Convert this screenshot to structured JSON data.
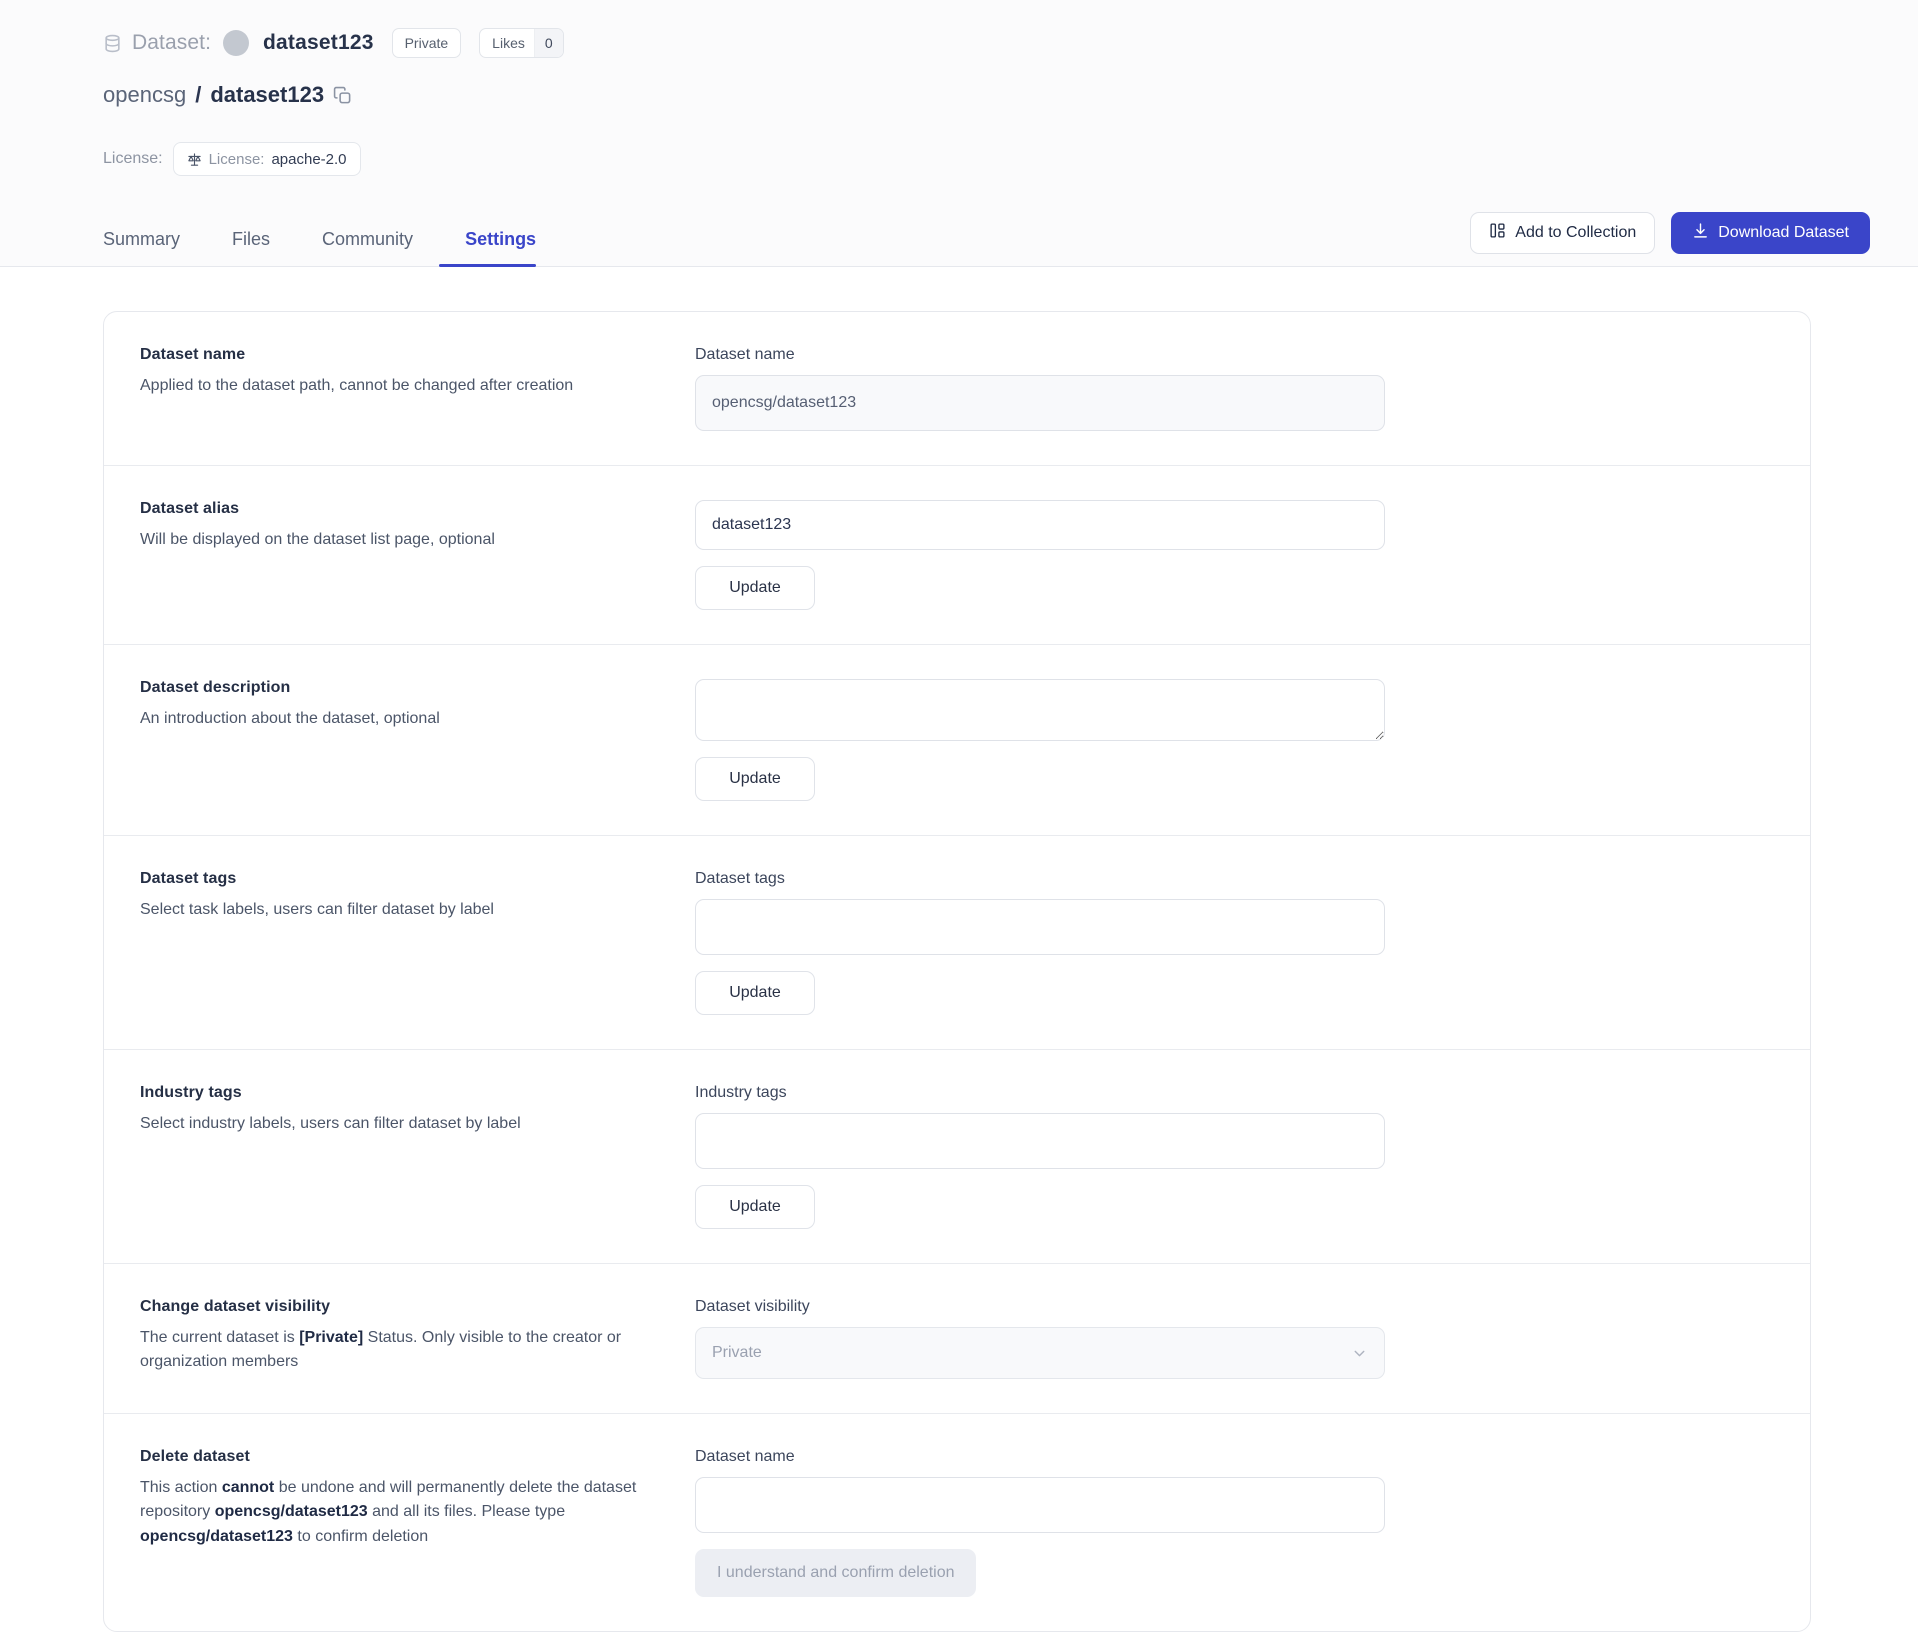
{
  "header": {
    "kicker": "Dataset:",
    "dataset_name": "dataset123",
    "private_badge": "Private",
    "likes_label": "Likes",
    "likes_count": "0",
    "owner": "opencsg",
    "separator": "/",
    "repo": "dataset123",
    "license_label": "License:",
    "license_badge_label": "License:",
    "license_value": "apache-2.0",
    "accent_color": "#3a45c9"
  },
  "tabs": [
    {
      "label": "Summary",
      "active": false
    },
    {
      "label": "Files",
      "active": false
    },
    {
      "label": "Community",
      "active": false
    },
    {
      "label": "Settings",
      "active": true
    }
  ],
  "actions": {
    "add_to_collection": "Add to Collection",
    "download_dataset": "Download Dataset"
  },
  "sections": {
    "dataset_name": {
      "title": "Dataset name",
      "desc": "Applied to the dataset path, cannot be changed after creation",
      "field_label": "Dataset name",
      "value": "opencsg/dataset123"
    },
    "dataset_alias": {
      "title": "Dataset alias",
      "desc": "Will be displayed on the dataset list page, optional",
      "value": "dataset123",
      "button": "Update"
    },
    "dataset_description": {
      "title": "Dataset description",
      "desc": "An introduction about the dataset, optional",
      "value": "",
      "button": "Update"
    },
    "dataset_tags": {
      "title": "Dataset tags",
      "desc": "Select task labels, users can filter dataset by label",
      "field_label": "Dataset tags",
      "value": "",
      "button": "Update"
    },
    "industry_tags": {
      "title": "Industry tags",
      "desc": "Select industry labels, users can filter dataset by label",
      "field_label": "Industry tags",
      "value": "",
      "button": "Update"
    },
    "visibility": {
      "title": "Change dataset visibility",
      "desc_pre": "The current dataset is ",
      "desc_bold": "[Private]",
      "desc_post": " Status. Only visible to the creator or organization members",
      "field_label": "Dataset visibility",
      "selected": "Private"
    },
    "delete": {
      "title": "Delete dataset",
      "desc_1a": "This action ",
      "desc_1b": "cannot",
      "desc_1c": " be undone and will permanently delete the dataset repository ",
      "desc_1d": "opencsg/dataset123",
      "desc_1e": " and all its files. Please type ",
      "desc_1f": "opencsg/dataset123",
      "desc_1g": " to confirm deletion",
      "field_label": "Dataset name",
      "value": "",
      "button": "I understand and confirm deletion"
    }
  }
}
